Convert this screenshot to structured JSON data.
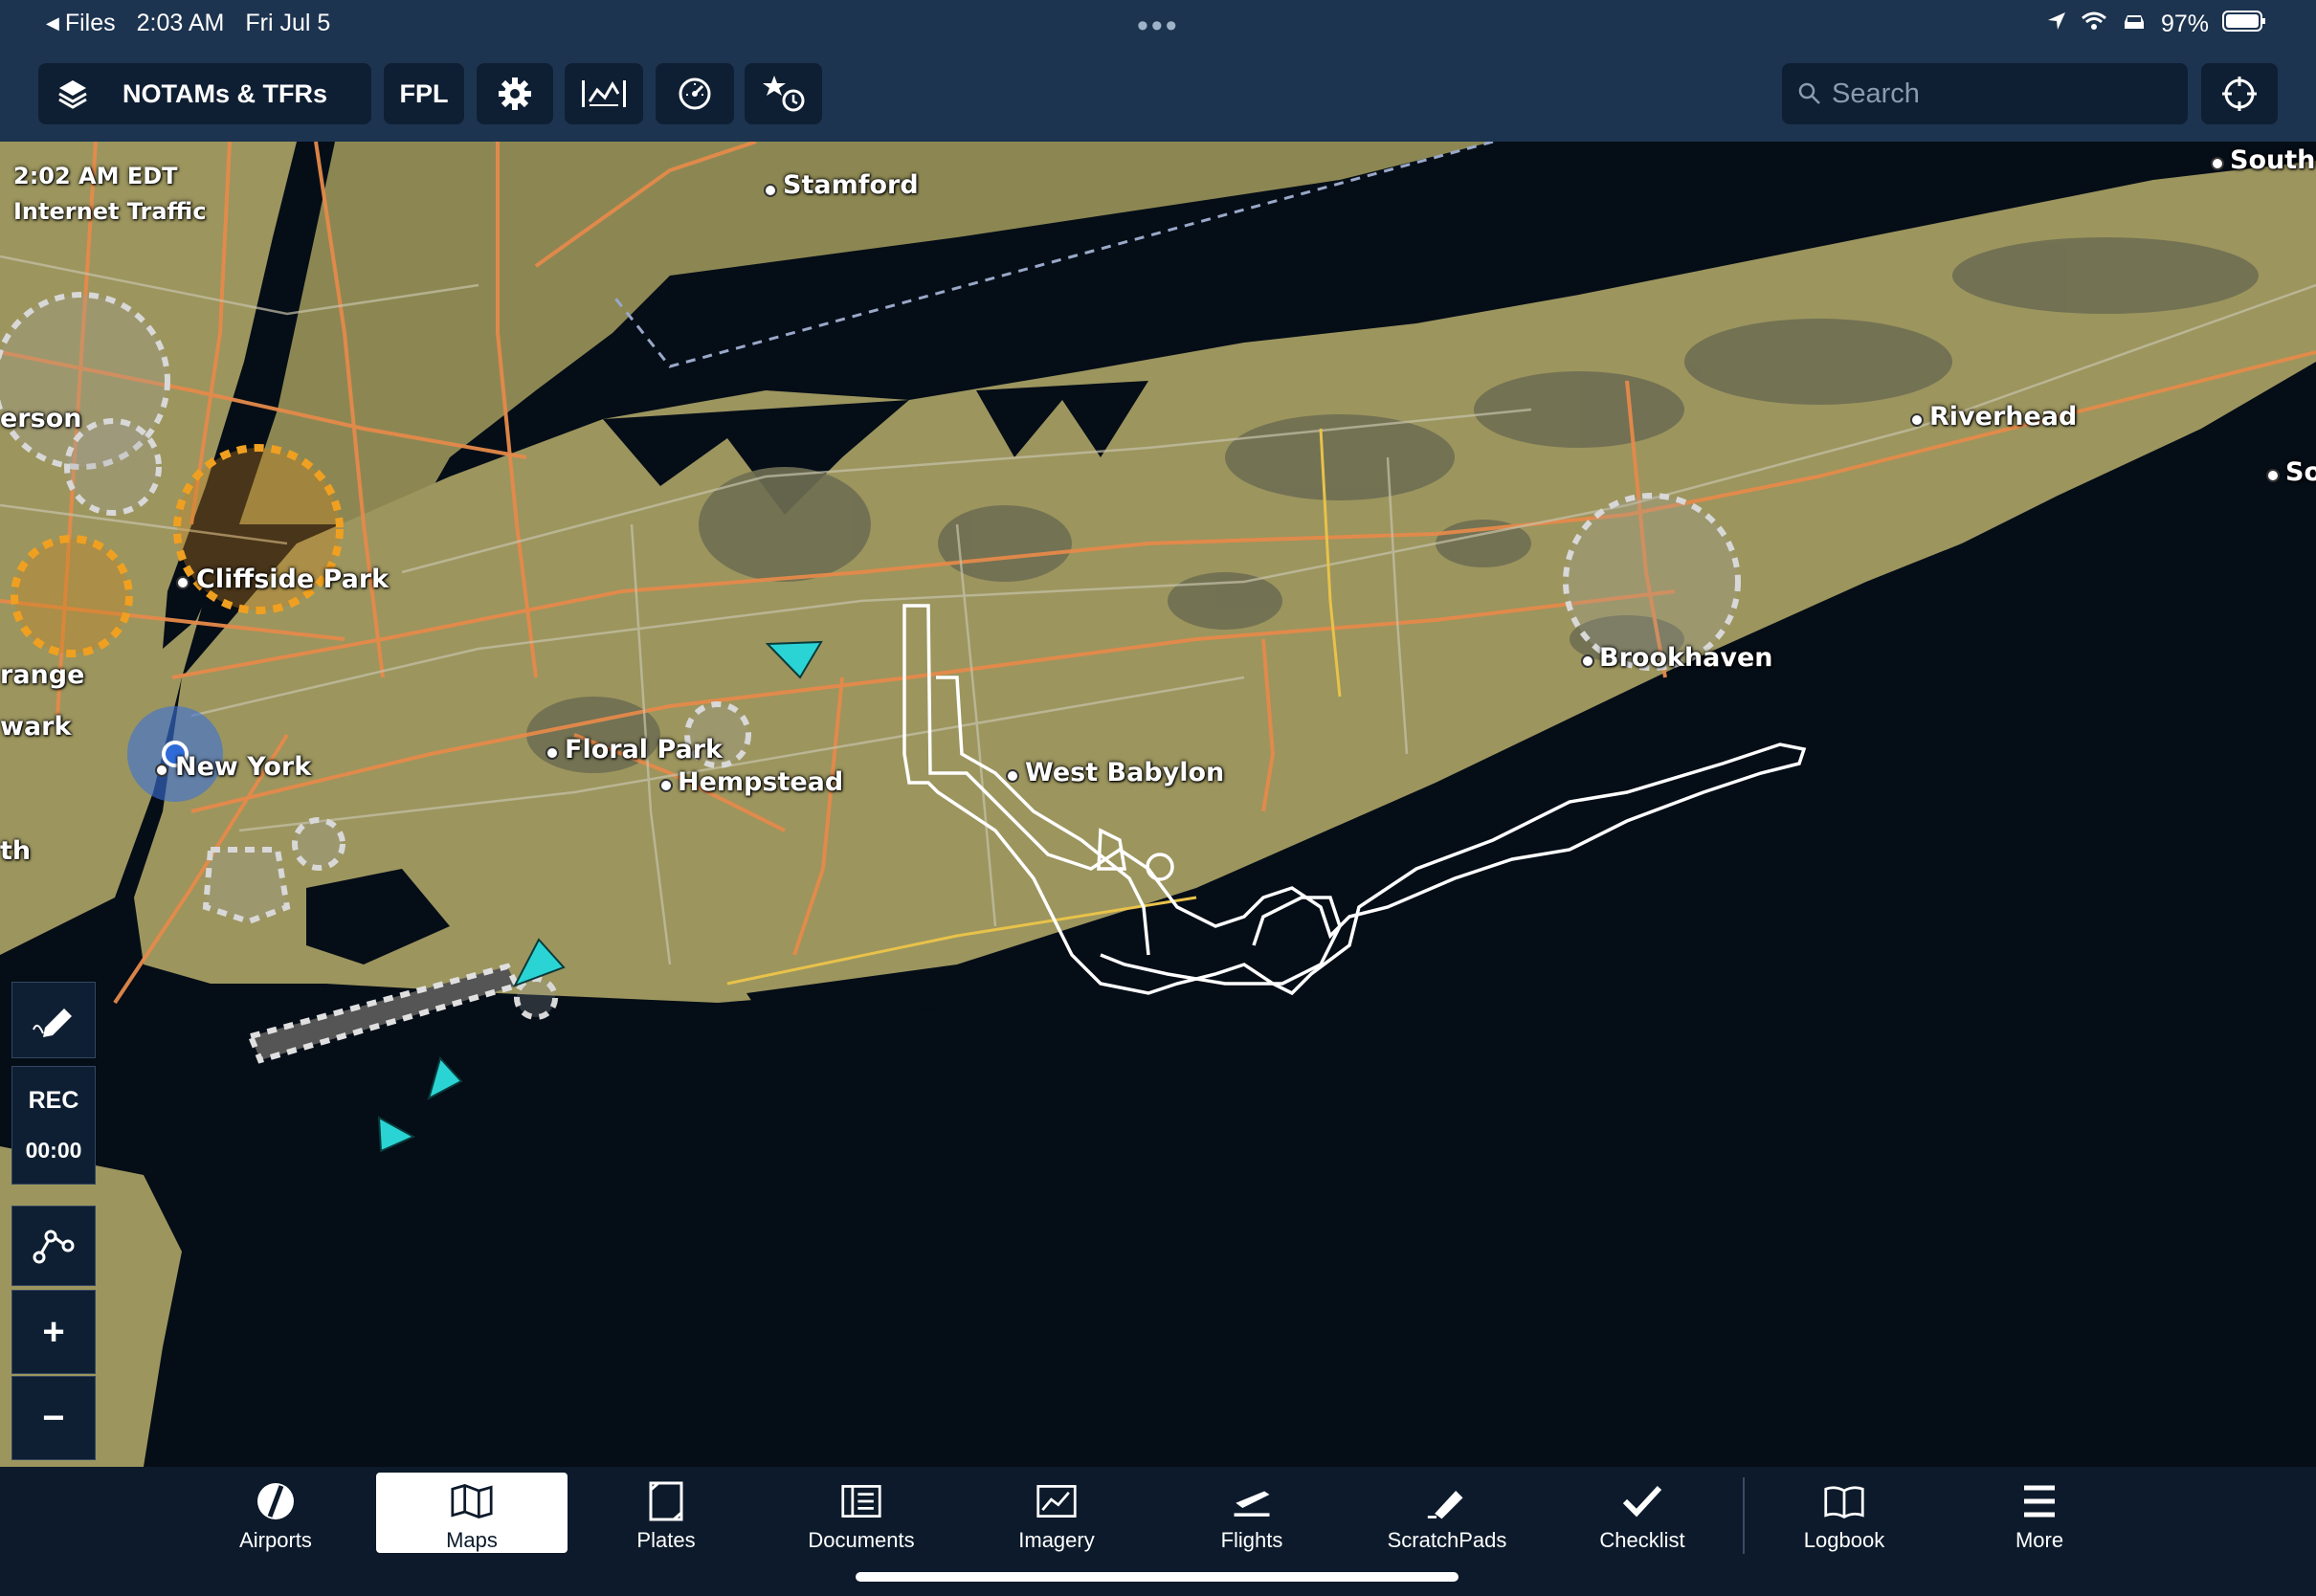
{
  "status_bar": {
    "back_label": "Files",
    "time": "2:03 AM",
    "date": "Fri Jul 5",
    "battery": "97%"
  },
  "toolbar": {
    "layer_label": "NOTAMs & TFRs",
    "fpl_label": "FPL",
    "search_placeholder": "Search"
  },
  "map": {
    "time_label": "2:02 AM EDT",
    "traffic_label": "Internet Traffic",
    "places": {
      "stamford": "Stamford",
      "southold": "Southo",
      "erson": "erson",
      "cliffside_park": "Cliffside Park",
      "range": "range",
      "wark": "wark",
      "new_york": "New York",
      "th": "th",
      "floral_park": "Floral Park",
      "hempstead": "Hempstead",
      "west_babylon": "West Babylon",
      "riverhead": "Riverhead",
      "so": "So",
      "brookhaven": "Brookhaven"
    },
    "rec_label": "REC",
    "rec_timer": "00:00",
    "colors": {
      "land": "#9c955e",
      "water": "#050d17",
      "highway": "#e58a4a",
      "track": "#ffffff",
      "traffic": "#2bd4d4",
      "ownship": "#2e6bd8"
    }
  },
  "tabs": [
    {
      "label": "Airports",
      "icon": "airport-icon"
    },
    {
      "label": "Maps",
      "icon": "map-icon",
      "active": true
    },
    {
      "label": "Plates",
      "icon": "plates-icon"
    },
    {
      "label": "Documents",
      "icon": "documents-icon"
    },
    {
      "label": "Imagery",
      "icon": "imagery-icon"
    },
    {
      "label": "Flights",
      "icon": "flights-icon"
    },
    {
      "label": "ScratchPads",
      "icon": "scratchpad-icon"
    },
    {
      "label": "Checklist",
      "icon": "checklist-icon"
    },
    {
      "label": "Logbook",
      "icon": "logbook-icon"
    },
    {
      "label": "More",
      "icon": "more-icon"
    }
  ]
}
